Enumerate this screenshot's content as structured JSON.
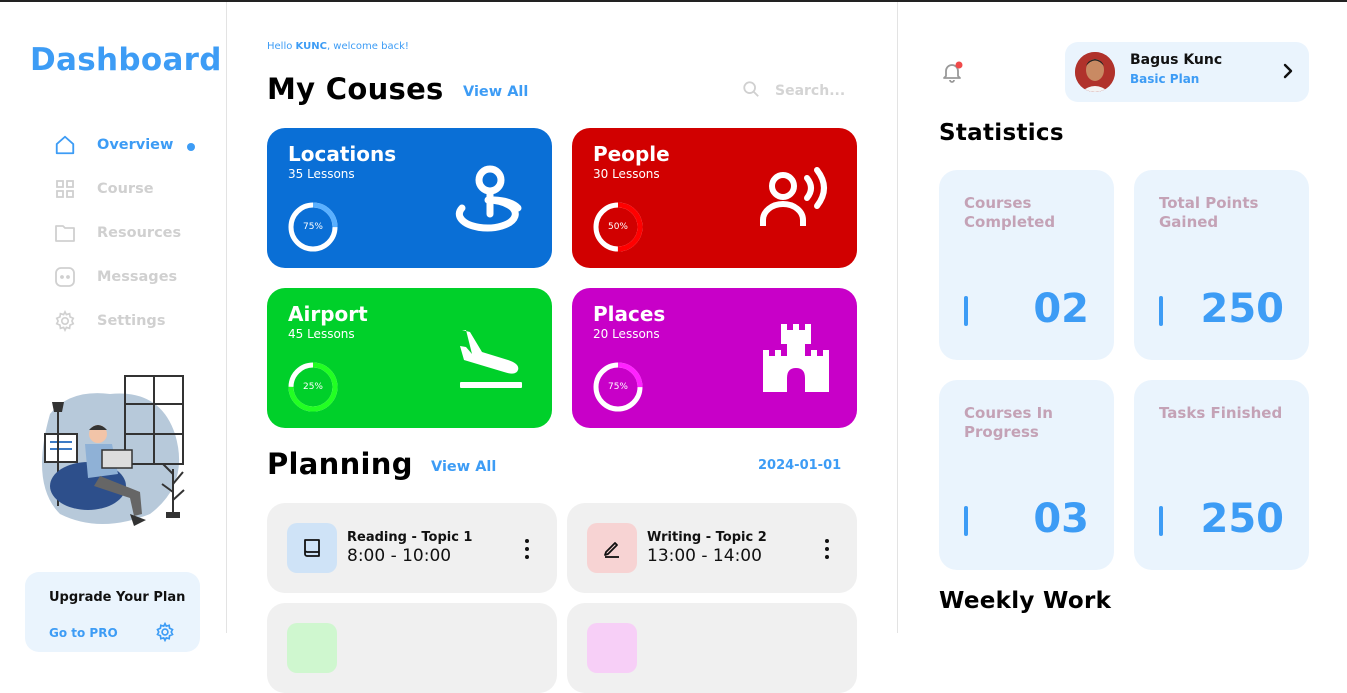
{
  "sidebar": {
    "logo": "Dashboard",
    "items": [
      {
        "label": "Overview",
        "icon": "home-icon"
      },
      {
        "label": "Course",
        "icon": "grid-icon"
      },
      {
        "label": "Resources",
        "icon": "folder-icon"
      },
      {
        "label": "Messages",
        "icon": "message-icon"
      },
      {
        "label": "Settings",
        "icon": "gear-icon"
      }
    ],
    "upgrade": {
      "title": "Upgrade Your Plan",
      "link": "Go to PRO"
    }
  },
  "main": {
    "hello_prefix": "Hello ",
    "hello_name": "KUNC",
    "hello_suffix": ", welcome back!",
    "courses_title": "My Couses",
    "courses_view_all": "View All",
    "search_placeholder": "Search...",
    "courses": [
      {
        "title": "Locations",
        "lessons": "35 Lessons",
        "progress": "75%",
        "color": "#0a6fd6",
        "ring": "#ffffff",
        "icon": "map-pin-icon"
      },
      {
        "title": "People",
        "lessons": "30 Lessons",
        "progress": "50%",
        "color": "#d10000",
        "ring": "#ff0000",
        "icon": "user-voice-icon"
      },
      {
        "title": "Airport",
        "lessons": "45 Lessons",
        "progress": "25%",
        "color": "#00d02a",
        "ring": "#00ff22",
        "icon": "airplane-landing-icon"
      },
      {
        "title": "Places",
        "lessons": "20 Lessons",
        "progress": "75%",
        "color": "#c800c8",
        "ring": "#ff22ff",
        "icon": "castle-icon"
      }
    ],
    "planning_title": "Planning",
    "planning_view_all": "View All",
    "date": "2024-01-01",
    "plans": [
      {
        "title": "Reading - Topic 1",
        "time": "8:00 - 10:00",
        "icon": "book-icon",
        "bg": "#cfe3f7"
      },
      {
        "title": "Writing - Topic 2",
        "time": "13:00 - 14:00",
        "icon": "pencil-icon",
        "bg": "#f7d3d3"
      }
    ]
  },
  "right": {
    "profile": {
      "name": "Bagus Kunc",
      "plan": "Basic Plan"
    },
    "stats_title": "Statistics",
    "stats": [
      {
        "label": "Courses Completed",
        "value": "02"
      },
      {
        "label": "Total Points Gained",
        "value": "250"
      },
      {
        "label": "Courses In Progress",
        "value": "03"
      },
      {
        "label": "Tasks Finished",
        "value": "250"
      }
    ],
    "weekly_title": "Weekly Work"
  },
  "colors": {
    "accent": "#3d9cf5",
    "stat_bg": "#eaf4fd",
    "stat_label": "#c4a2b6"
  }
}
